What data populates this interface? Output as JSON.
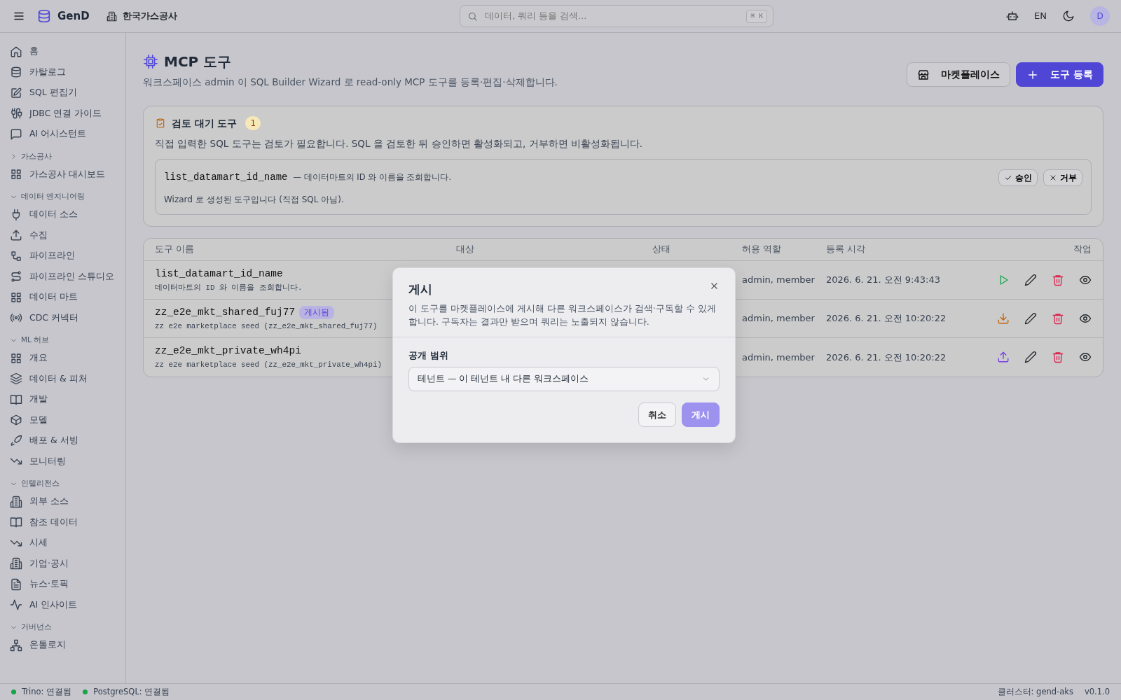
{
  "header": {
    "brand": "GenD",
    "org": "한국가스공사",
    "search": {
      "placeholder": "데이터, 쿼리 등을 검색...",
      "shortcut": "⌘ K"
    },
    "language": "EN",
    "avatar": "D"
  },
  "sidebar": {
    "sections": [
      {
        "items": [
          "홈",
          "카탈로그",
          "SQL 편집기",
          "JDBC 연결 가이드",
          "AI 어시스턴트"
        ]
      },
      {
        "title": "가스공사",
        "expanded": false,
        "items": [
          "가스공사 대시보드"
        ]
      },
      {
        "title": "데이터 엔지니어링",
        "expanded": true,
        "items": [
          "데이터 소스",
          "수집",
          "파이프라인",
          "파이프라인 스튜디오",
          "데이터 마트",
          "CDC 커넥터"
        ]
      },
      {
        "title": "ML 허브",
        "expanded": true,
        "items": [
          "개요",
          "데이터 & 피처",
          "개발",
          "모델",
          "배포 & 서빙",
          "모니터링"
        ]
      },
      {
        "title": "인텔리전스",
        "expanded": true,
        "items": [
          "외부 소스",
          "참조 데이터",
          "시세",
          "기업·공시",
          "뉴스·토픽",
          "AI 인사이트"
        ]
      },
      {
        "title": "거버넌스",
        "expanded": true,
        "items": [
          "온톨로지"
        ]
      }
    ]
  },
  "page": {
    "title": "MCP 도구",
    "subtitle": "워크스페이스 admin 이 SQL Builder Wizard 로 read-only MCP 도구를 등록·편집·삭제합니다.",
    "buttons": [
      {
        "kind": "outline",
        "label": "마켓플레이스"
      },
      {
        "kind": "primary",
        "label": "도구 등록"
      }
    ]
  },
  "pending": {
    "title": "검토 대기 도구",
    "count": "1",
    "description": "직접 입력한 SQL 도구는 검토가 필요합니다. SQL 을 검토한 뒤 승인하면 활성화되고, 거부하면 비활성화됩니다.",
    "items": [
      {
        "name": "list_datamart_id_name",
        "description": "— 데이터마트의 ID 와 이름을 조회합니다.",
        "note": "Wizard 로 생성된 도구입니다 (직접 SQL 아님).",
        "actions": [
          {
            "kind": "approve",
            "label": "승인"
          },
          {
            "kind": "reject",
            "label": "거부"
          }
        ]
      }
    ]
  },
  "table": {
    "columns": [
      "도구 이름",
      "대상",
      "상태",
      "허용 역할",
      "등록 시각",
      "작업"
    ],
    "rows": [
      {
        "name": "list_datamart_id_name",
        "description": "데이터마트의 ID 와 이름을 조회합니다.",
        "roles": "admin, member",
        "registered": "2026. 6. 21. 오전 9:43:43",
        "kind": "run"
      },
      {
        "name": "zz_e2e_mkt_shared_fuj77",
        "badge": "게시됨",
        "description": "zz e2e marketplace seed (zz_e2e_mkt_shared_fuj77)",
        "roles": "admin, member",
        "registered": "2026. 6. 21. 오전 10:20:22",
        "kind": "download"
      },
      {
        "name": "zz_e2e_mkt_private_wh4pi",
        "description": "zz e2e marketplace seed (zz_e2e_mkt_private_wh4pi)",
        "roles": "admin, member",
        "registered": "2026. 6. 21. 오전 10:20:22",
        "kind": "upload"
      }
    ]
  },
  "modal": {
    "title": "게시",
    "description": "이 도구를 마켓플레이스에 게시해 다른 워크스페이스가 검색·구독할 수 있게 합니다. 구독자는 결과만 받으며 쿼리는 노출되지 않습니다.",
    "field_label": "공개 범위",
    "value": "테넌트 — 이 테넌트 내 다른 워크스페이스",
    "buttons": [
      {
        "kind": "cancel",
        "label": "취소"
      },
      {
        "kind": "submit",
        "label": "게시"
      }
    ]
  },
  "status_bar": {
    "connections": [
      {
        "label": "Trino: 연결됨",
        "color": "#16a34a"
      },
      {
        "label": "PostgreSQL: 연결됨",
        "color": "#16a34a"
      }
    ],
    "cluster": "클러스터: gend-aks",
    "version": "v0.1.0"
  }
}
